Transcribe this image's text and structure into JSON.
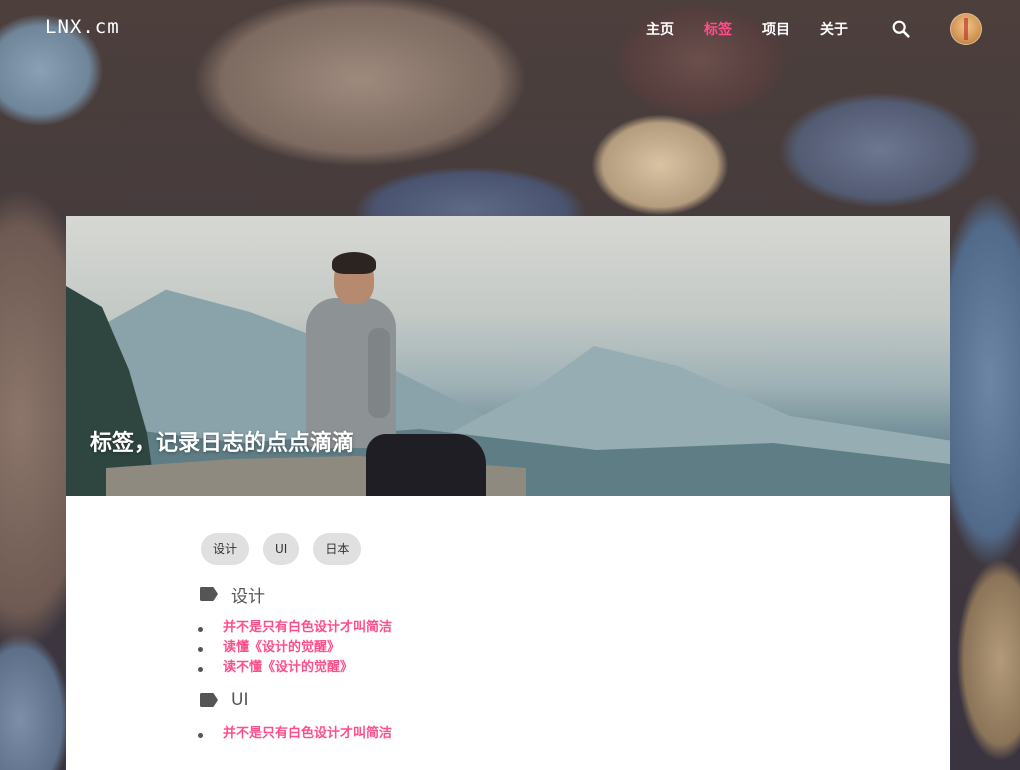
{
  "header": {
    "logo": "LNX.cm",
    "nav": [
      {
        "label": "主页",
        "active": false
      },
      {
        "label": "标签",
        "active": true
      },
      {
        "label": "项目",
        "active": false
      },
      {
        "label": "关于",
        "active": false
      }
    ],
    "search_icon": "search-icon",
    "avatar_icon": "avatar"
  },
  "hero": {
    "title": "标签，记录日志的点点滴滴"
  },
  "tags": [
    "设计",
    "UI",
    "日本"
  ],
  "sections": [
    {
      "icon": "tag-icon",
      "title": "设计",
      "posts": [
        "并不是只有白色设计才叫简洁",
        "读懂《设计的觉醒》",
        "读不懂《设计的觉醒》"
      ]
    },
    {
      "icon": "tag-icon",
      "title": "UI",
      "posts": [
        "并不是只有白色设计才叫简洁"
      ]
    }
  ],
  "colors": {
    "accent": "#ff4f8b",
    "chip_bg": "#e0e0e0",
    "text": "#555555"
  }
}
